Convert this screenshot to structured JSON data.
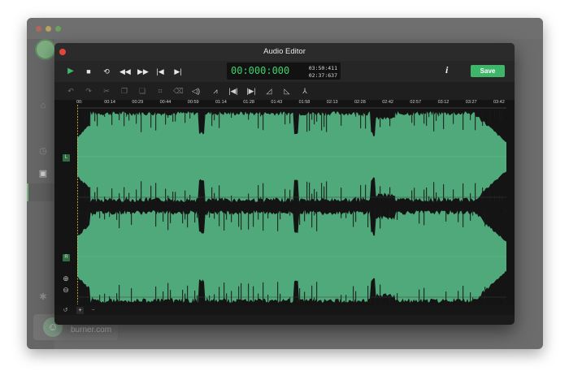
{
  "background_app": {
    "user_email": "burner.com"
  },
  "editor": {
    "title": "Audio Editor",
    "timer": {
      "current": "00:000:000",
      "duration_top": "03:50:411",
      "duration_bottom": "02:37:637"
    },
    "info_label": "i",
    "save_label": "Save",
    "ruler_labels": [
      "00:",
      "00:14",
      "00:29",
      "00:44",
      "00:59",
      "01:14",
      "01:28",
      "01:43",
      "01:58",
      "02:13",
      "02:28",
      "02:42",
      "02:57",
      "03:12",
      "03:27",
      "03:42"
    ],
    "channels": [
      {
        "label": "L"
      },
      {
        "label": "R"
      }
    ],
    "colors": {
      "waveform": "#4fa97a",
      "accent": "#3fb56a",
      "timer_text": "#3ed36b",
      "playhead": "#e3c531"
    }
  }
}
